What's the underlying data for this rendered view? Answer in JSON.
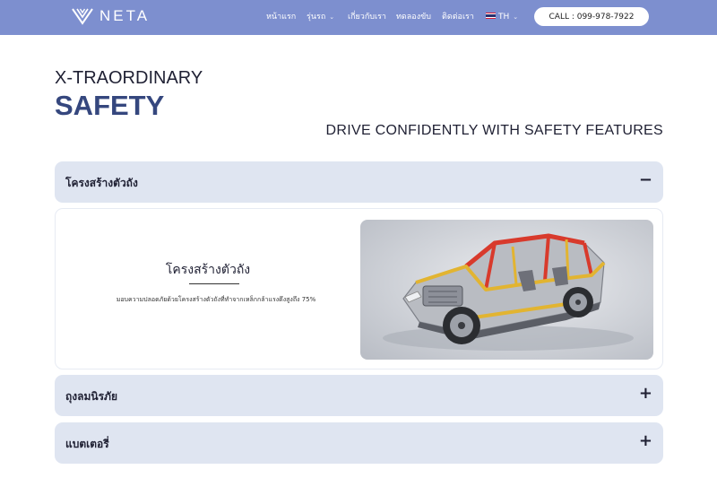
{
  "header": {
    "brand": "NETA",
    "nav": [
      {
        "label": "หน้าแรก"
      },
      {
        "label": "รุ่นรถ"
      },
      {
        "label": "เกี่ยวกับเรา"
      },
      {
        "label": "ทดลองขับ"
      },
      {
        "label": "ติดต่อเรา"
      },
      {
        "label": "TH"
      }
    ],
    "call_label": "CALL : 099-978-7922"
  },
  "hero": {
    "kicker": "X-TRAORDINARY",
    "title": "SAFETY",
    "subtitle": "DRIVE CONFIDENTLY WITH SAFETY FEATURES"
  },
  "accordion": [
    {
      "title": "โครงสร้างตัวถัง",
      "sign": "−",
      "expanded": true
    },
    {
      "title": "ถุงลมนิรภัย",
      "sign": "+",
      "expanded": false
    },
    {
      "title": "แบตเตอรี่",
      "sign": "+",
      "expanded": false
    }
  ],
  "panel": {
    "title": "โครงสร้างตัวถัง",
    "description": "มอบความปลอดภัยด้วยโครงสร้างตัวถังที่ทำจากเหล็กกล้าแรงดึงสูงถึง 75%"
  },
  "colors": {
    "header_bg": "#7d8fcf",
    "accent_title": "#35477e",
    "accordion_bg": "#dfe5f1"
  }
}
